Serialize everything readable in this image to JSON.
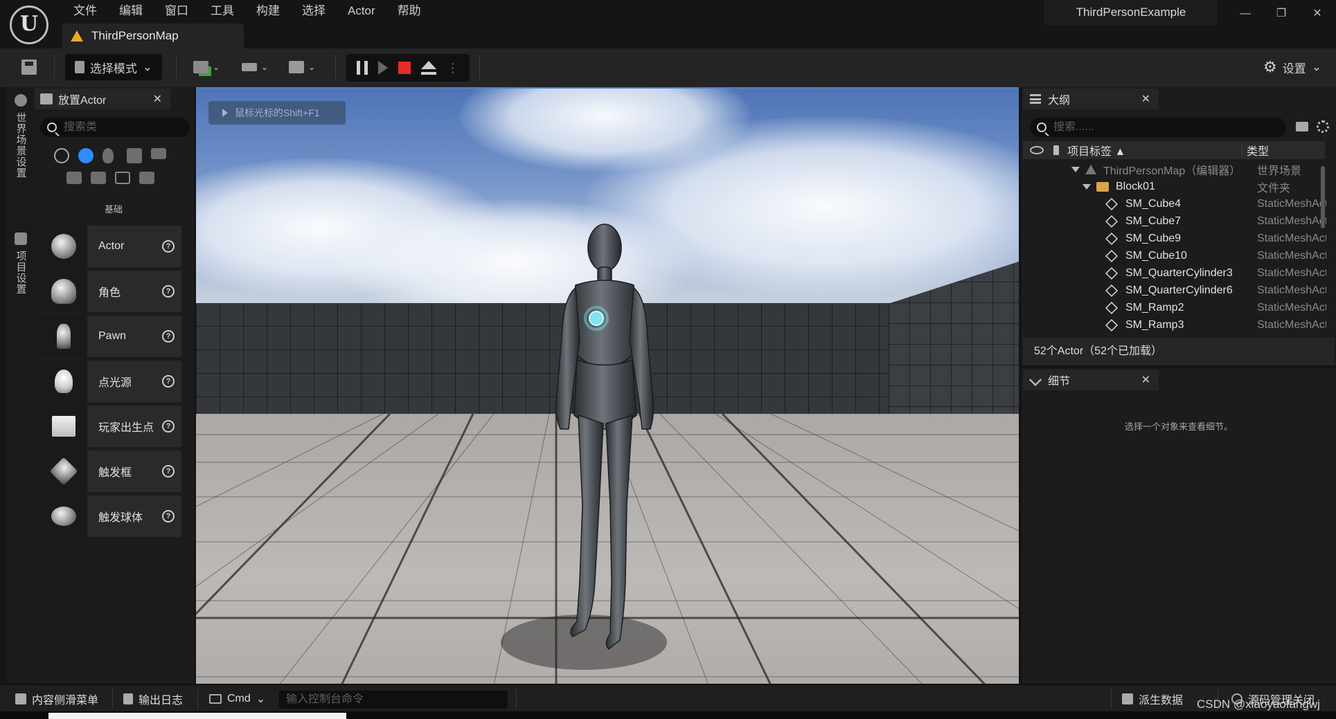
{
  "app": {
    "logo_text": "U",
    "menu": [
      "文件",
      "编辑",
      "窗口",
      "工具",
      "构建",
      "选择",
      "Actor",
      "帮助"
    ],
    "document_tab": "ThirdPersonMap",
    "project_name": "ThirdPersonExample",
    "window_controls": {
      "minimize": "—",
      "restore": "❐",
      "close": "✕"
    }
  },
  "toolbar": {
    "mode_label": "选择模式",
    "settings_label": "设置",
    "play_controls": [
      "pause-icon",
      "step-icon",
      "stop-icon",
      "eject-icon"
    ],
    "stop_color": "#e52b2b"
  },
  "left_strip": {
    "tabs": [
      "世界场景设置",
      "项目设置"
    ]
  },
  "place_actor": {
    "tab_label": "放置Actor",
    "search_placeholder": "搜索类",
    "category_label": "基础",
    "items": [
      {
        "label": "Actor",
        "icon": "sphere-icon"
      },
      {
        "label": "角色",
        "icon": "character-icon"
      },
      {
        "label": "Pawn",
        "icon": "pawn-icon"
      },
      {
        "label": "点光源",
        "icon": "point-light-icon"
      },
      {
        "label": "玩家出生点",
        "icon": "player-start-icon"
      },
      {
        "label": "触发框",
        "icon": "trigger-box-icon"
      },
      {
        "label": "触发球体",
        "icon": "trigger-sphere-icon"
      }
    ]
  },
  "viewport": {
    "hint": "鼠标光标的Shift+F1"
  },
  "outliner": {
    "tab_label": "大纲",
    "search_placeholder": "搜索......",
    "col_label": "项目标签 ▲",
    "col_type": "类型",
    "rows": [
      {
        "name": "ThirdPersonMap（编辑器）",
        "type": "世界场景",
        "kind": "map"
      },
      {
        "name": "Block01",
        "type": "文件夹",
        "kind": "folder"
      },
      {
        "name": "SM_Cube4",
        "type": "StaticMeshActor",
        "kind": "mesh"
      },
      {
        "name": "SM_Cube7",
        "type": "StaticMeshActor",
        "kind": "mesh"
      },
      {
        "name": "SM_Cube9",
        "type": "StaticMeshActor",
        "kind": "mesh"
      },
      {
        "name": "SM_Cube10",
        "type": "StaticMeshActor",
        "kind": "mesh"
      },
      {
        "name": "SM_QuarterCylinder3",
        "type": "StaticMeshActor",
        "kind": "mesh"
      },
      {
        "name": "SM_QuarterCylinder6",
        "type": "StaticMeshActor",
        "kind": "mesh"
      },
      {
        "name": "SM_Ramp2",
        "type": "StaticMeshActor",
        "kind": "mesh"
      },
      {
        "name": "SM_Ramp3",
        "type": "StaticMeshActor",
        "kind": "mesh"
      }
    ],
    "status": "52个Actor（52个已加载）"
  },
  "details": {
    "tab_label": "细节",
    "empty_text": "选择一个对象来查看细节。"
  },
  "statusbar": {
    "content_drawer": "内容侧滑菜单",
    "output_log": "输出日志",
    "cmd_label": "Cmd",
    "console_placeholder": "输入控制台命令",
    "derived_data": "派生数据",
    "source_control": "源码管理关闭"
  },
  "watermark": "CSDN @xiaoyaofangwj"
}
